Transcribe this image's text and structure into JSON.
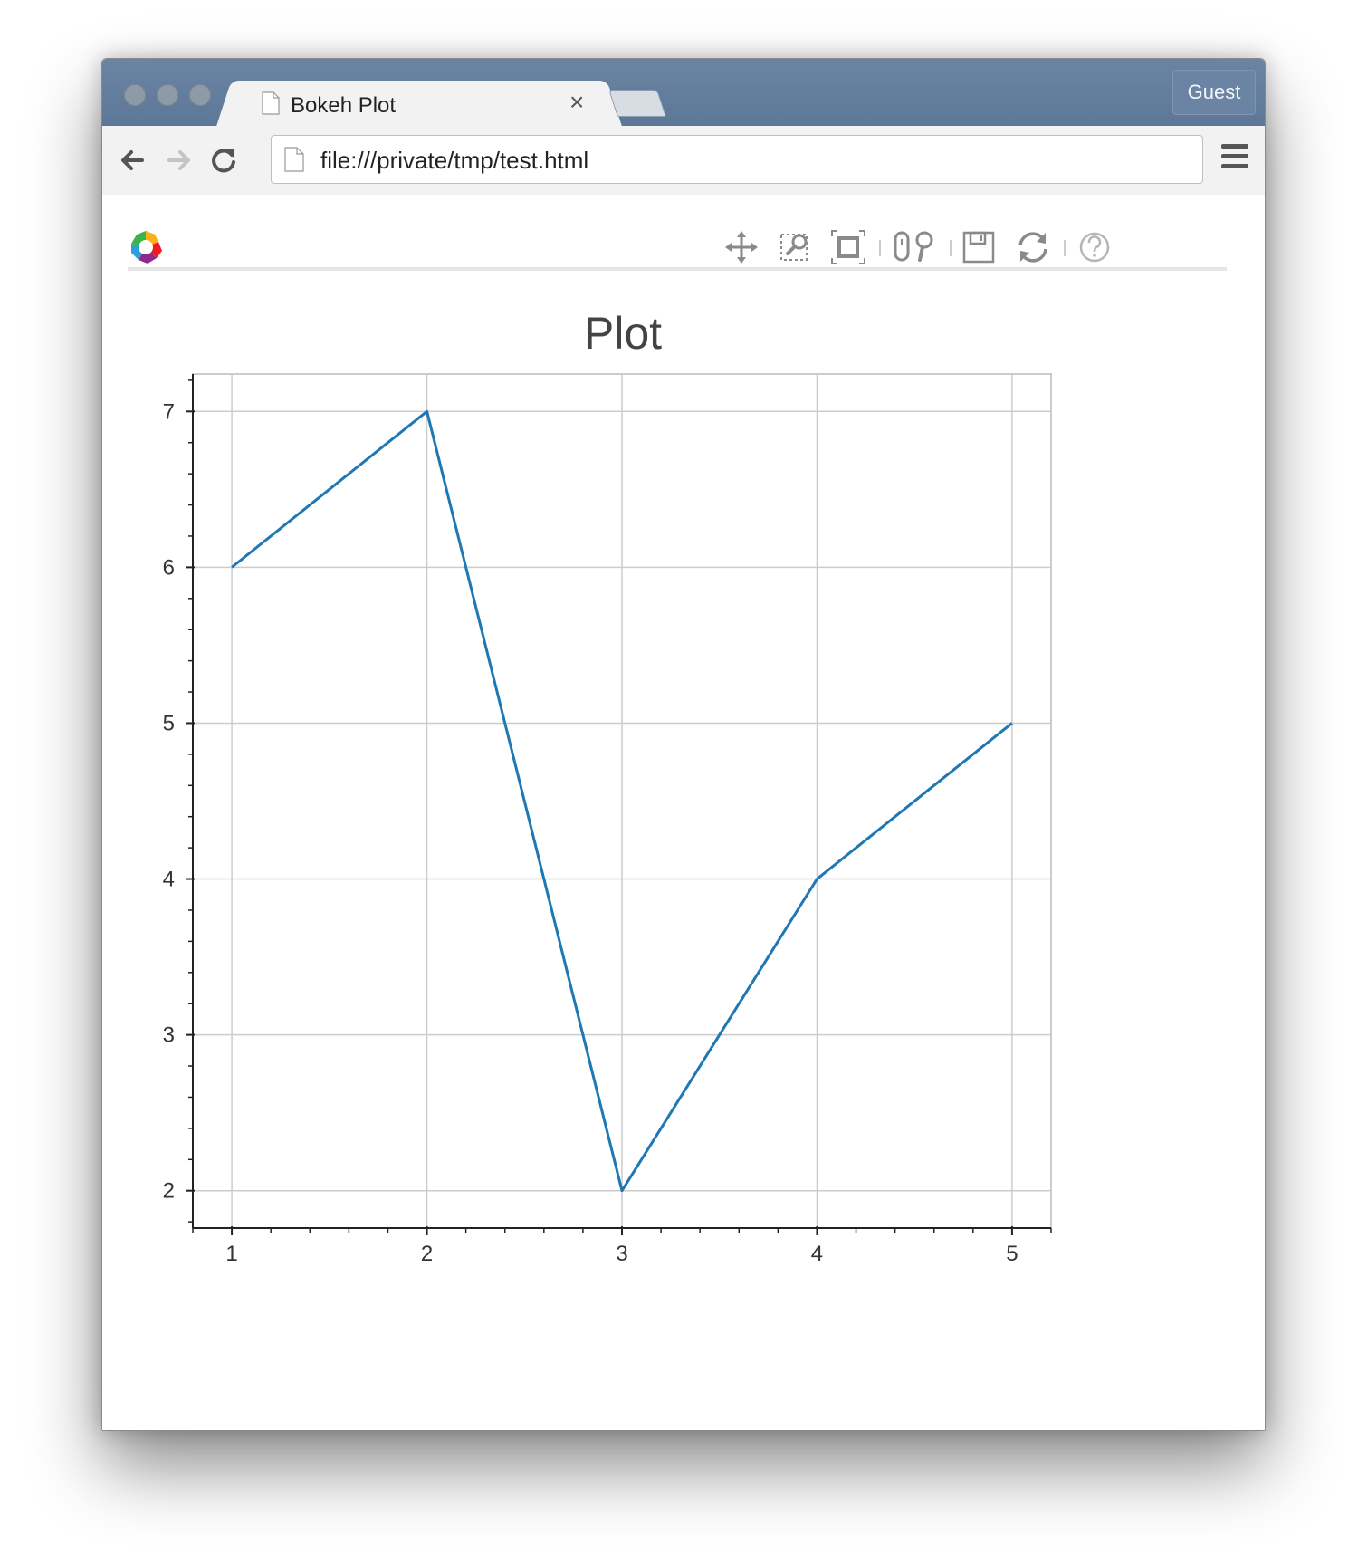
{
  "browser": {
    "tab_title": "Bokeh Plot",
    "tab_close": "×",
    "guest_label": "Guest",
    "url": "file:///private/tmp/test.html",
    "back_icon": "←",
    "forward_icon": "→",
    "reload_icon": "⟳"
  },
  "bokeh_toolbar": {
    "tools": [
      "pan",
      "box-zoom",
      "resize",
      "wheel-zoom",
      "save",
      "reset",
      "help"
    ],
    "active_tools": [
      "pan",
      "wheel-zoom"
    ],
    "active_color": "#26aae1"
  },
  "chart_data": {
    "type": "line",
    "title": "Plot",
    "xlabel": "",
    "ylabel": "",
    "x": [
      1,
      2,
      3,
      4,
      5
    ],
    "series": [
      {
        "values": [
          6,
          7,
          2,
          4,
          5
        ],
        "color": "#1f77b4"
      }
    ],
    "xlim": [
      0.8,
      5.2
    ],
    "ylim": [
      1.76,
      7.24
    ],
    "xticks": [
      1,
      2,
      3,
      4,
      5
    ],
    "yticks": [
      2,
      3,
      4,
      5,
      6,
      7
    ],
    "grid": true
  }
}
